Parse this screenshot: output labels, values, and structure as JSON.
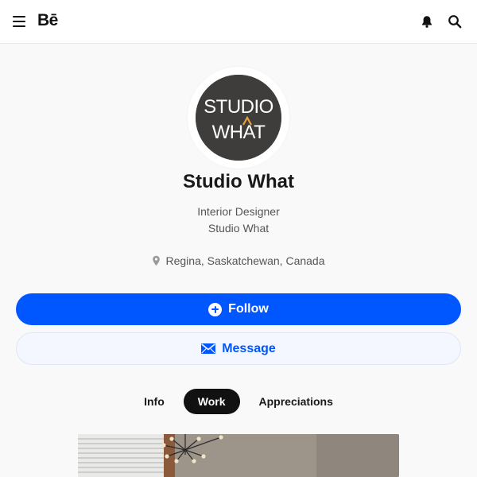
{
  "header": {
    "logo_text": "Bē",
    "icons": [
      "menu-icon",
      "notification-bell-icon",
      "search-icon"
    ]
  },
  "profile": {
    "avatar_text_line1": "STUDIO",
    "avatar_text_line2": "WHAT",
    "name": "Studio What",
    "occupation": "Interior Designer",
    "company": "Studio What",
    "location": "Regina, Saskatchewan, Canada",
    "location_icon": "location-pin-icon"
  },
  "actions": {
    "follow_label": "Follow",
    "follow_icon": "plus-circle-icon",
    "message_label": "Message",
    "message_icon": "envelope-icon"
  },
  "tabs": [
    {
      "label": "Info",
      "active": false
    },
    {
      "label": "Work",
      "active": true
    },
    {
      "label": "Appreciations",
      "active": false
    }
  ],
  "colors": {
    "accent": "#0057ff",
    "page_background": "#f9f9f9",
    "avatar_background": "#3f3d3c",
    "avatar_accent": "#e8a23a"
  }
}
